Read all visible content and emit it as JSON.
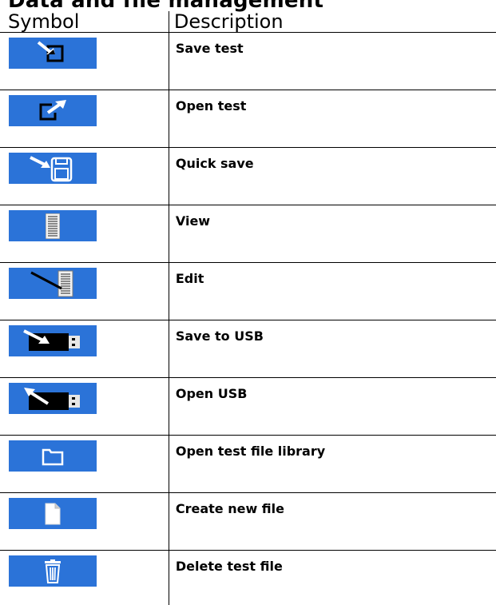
{
  "section_title": "Data and file management",
  "table": {
    "headers": [
      "Symbol",
      "Description"
    ],
    "rows": [
      {
        "icon": "save-test-icon",
        "label": "Save test"
      },
      {
        "icon": "open-test-icon",
        "label": "Open test"
      },
      {
        "icon": "quick-save-icon",
        "label": "Quick save"
      },
      {
        "icon": "view-icon",
        "label": "View"
      },
      {
        "icon": "edit-icon",
        "label": "Edit"
      },
      {
        "icon": "save-to-usb-icon",
        "label": "Save to USB"
      },
      {
        "icon": "open-usb-icon",
        "label": "Open USB"
      },
      {
        "icon": "test-file-library-icon",
        "label": "Open test file library"
      },
      {
        "icon": "new-file-icon",
        "label": "Create new file"
      },
      {
        "icon": "delete-file-icon",
        "label": "Delete test file"
      }
    ]
  },
  "colors": {
    "button_blue": "#2b73d8",
    "usb_body": "#000000"
  }
}
